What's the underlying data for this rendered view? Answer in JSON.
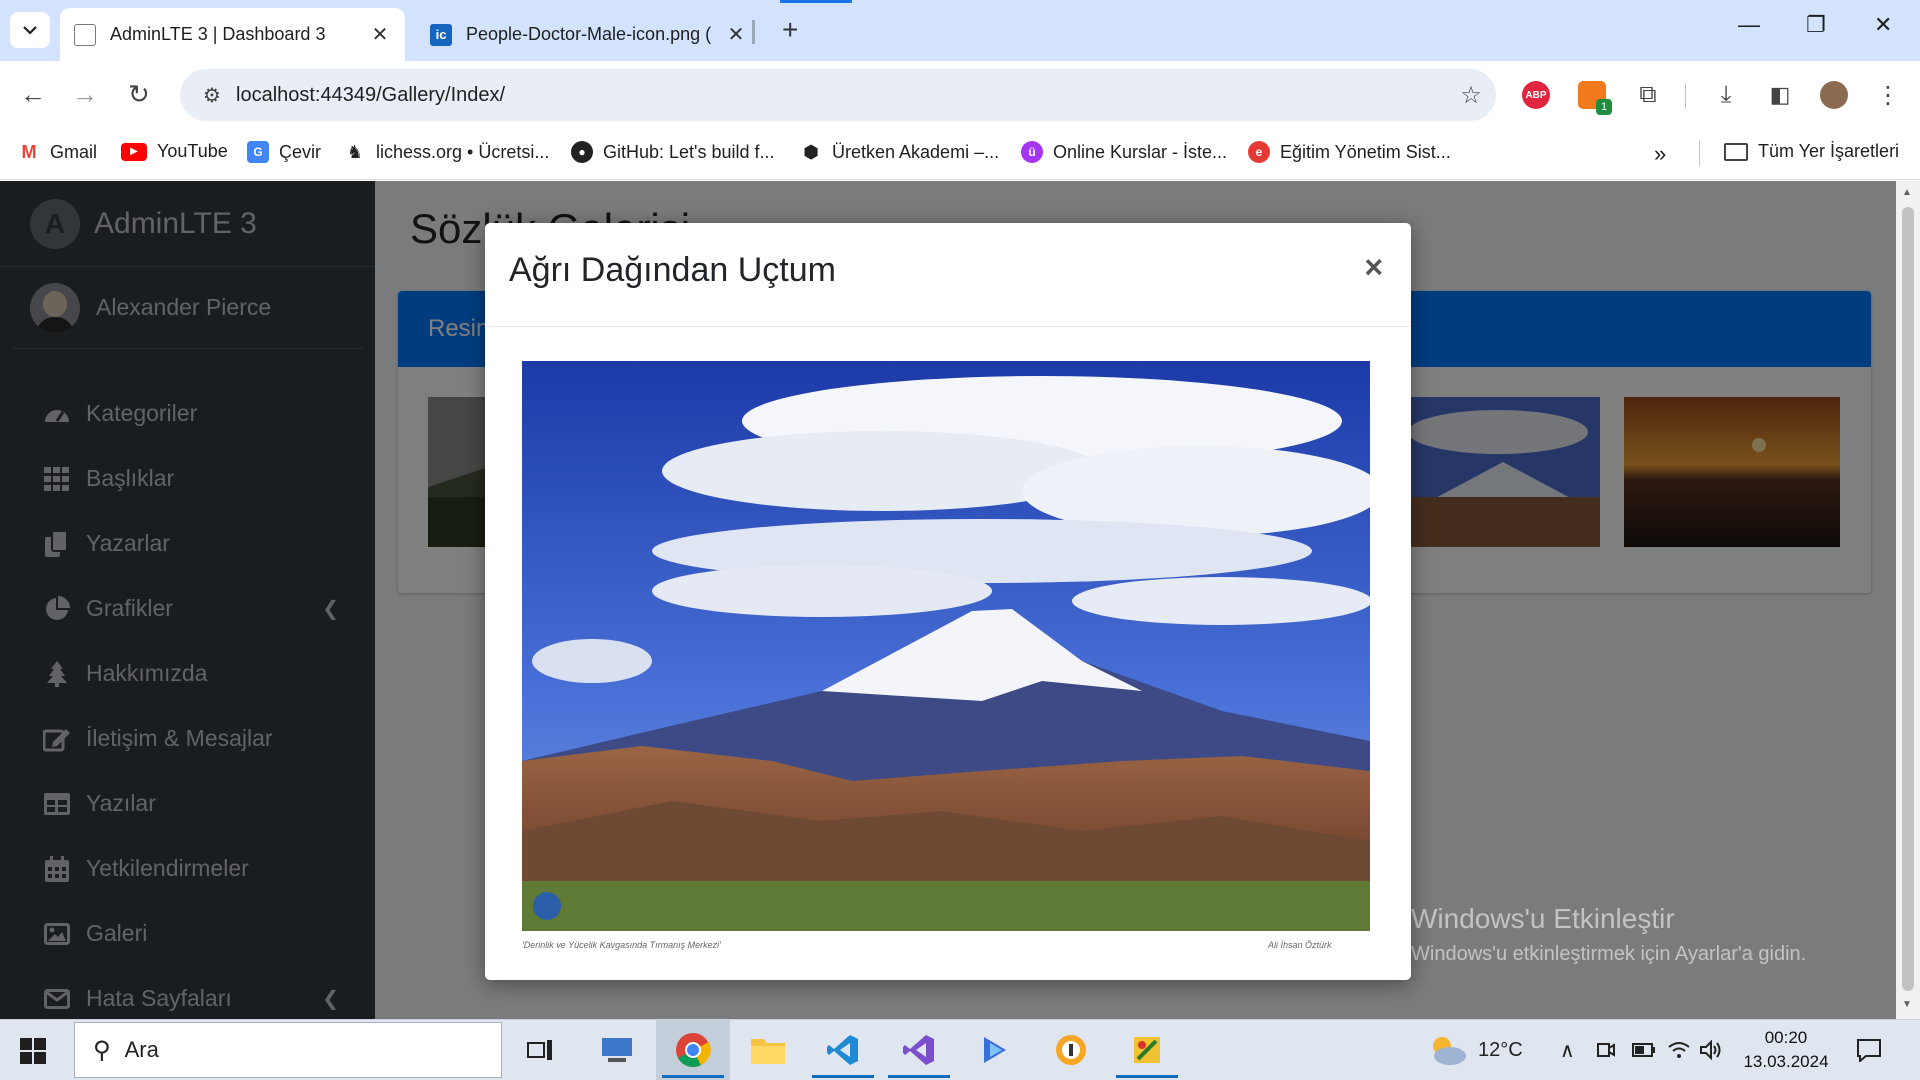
{
  "browser": {
    "tabs": [
      {
        "title": "AdminLTE 3 | Dashboard 3",
        "active": true
      },
      {
        "title": "People-Doctor-Male-icon.png (",
        "favicon_text": "ic",
        "active": false
      }
    ],
    "url": "localhost:44349/Gallery/Index/",
    "bookmarks": [
      {
        "label": "Gmail",
        "icon": "gmail-icon"
      },
      {
        "label": "YouTube",
        "icon": "youtube-icon"
      },
      {
        "label": "Çevir",
        "icon": "translate-icon"
      },
      {
        "label": "lichess.org • Ücretsi...",
        "icon": "lichess-icon"
      },
      {
        "label": "GitHub: Let's build f...",
        "icon": "github-icon"
      },
      {
        "label": "Üretken Akademi –...",
        "icon": "uretken-icon"
      },
      {
        "label": "Online Kurslar - İste...",
        "icon": "udemy-icon"
      },
      {
        "label": "Eğitim Yönetim Sist...",
        "icon": "egitim-icon"
      }
    ],
    "all_bookmarks": "Tüm Yer İşaretleri",
    "extensions": {
      "abp": "ABP",
      "orange_badge": "1"
    }
  },
  "sidebar": {
    "brand": "AdminLTE 3",
    "user": "Alexander Pierce",
    "items": [
      {
        "label": "Kategoriler",
        "icon": "tachometer-icon"
      },
      {
        "label": "Başlıklar",
        "icon": "grid-icon"
      },
      {
        "label": "Yazarlar",
        "icon": "copy-icon"
      },
      {
        "label": "Grafikler",
        "icon": "pie-chart-icon",
        "has_submenu": true
      },
      {
        "label": "Hakkımızda",
        "icon": "tree-icon"
      },
      {
        "label": "İletişim & Mesajlar",
        "icon": "edit-icon"
      },
      {
        "label": "Yazılar",
        "icon": "table-icon"
      },
      {
        "label": "Yetkilendirmeler",
        "icon": "calendar-icon"
      },
      {
        "label": "Galeri",
        "icon": "image-icon"
      },
      {
        "label": "Hata Sayfaları",
        "icon": "envelope-icon",
        "has_submenu": true
      }
    ]
  },
  "content": {
    "title": "Sözlük Galerisi",
    "card_header": "Resimler"
  },
  "modal": {
    "title": "Ağrı Dağından Uçtum",
    "close": "×",
    "photo_caption_left": "'Derinlik ve Yücelik Kavgasında Tırmanış Merkezi'",
    "photo_caption_right": "Ali İhsan Öztürk"
  },
  "watermark": {
    "title": "Windows'u Etkinleştir",
    "subtitle": "Windows'u etkinleştirmek için Ayarlar'a gidin."
  },
  "taskbar": {
    "search_placeholder": "Ara",
    "weather": "12°C",
    "time": "00:20",
    "date": "13.03.2024"
  },
  "colors": {
    "sidebar_bg": "#343a40",
    "primary": "#007bff",
    "chrome_tabstrip": "#d3e3fd"
  }
}
